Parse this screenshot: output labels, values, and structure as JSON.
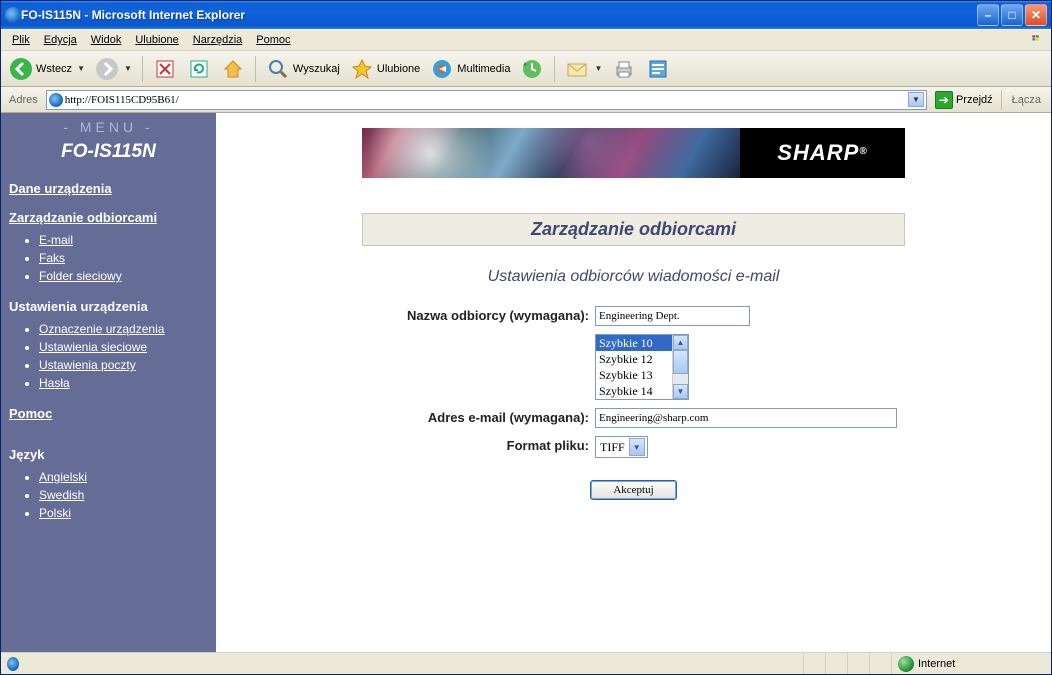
{
  "window": {
    "title": "FO-IS115N - Microsoft Internet Explorer"
  },
  "menubar": {
    "file": "Plik",
    "edit": "Edycja",
    "view": "Widok",
    "favorites": "Ulubione",
    "tools": "Narzędzia",
    "help": "Pomoc"
  },
  "toolbar": {
    "back": "Wstecz",
    "search": "Wyszukaj",
    "favorites": "Ulubione",
    "media": "Multimedia"
  },
  "addrbar": {
    "label": "Adres",
    "url": "http://FOIS115CD95B61/",
    "go": "Przejdź",
    "links": "Łącza"
  },
  "sidebar": {
    "menu_header": "- MENU -",
    "model": "FO-IS115N",
    "device_data": "Dane urządzenia",
    "recipients_mgmt": "Zarządzanie odbiorcami",
    "recip_items": {
      "email": "E-mail",
      "fax": "Faks",
      "netfolder": "Folder sieciowy"
    },
    "device_settings": "Ustawienia urządzenia",
    "settings_items": {
      "device_label": "Oznaczenie urządzenia",
      "network": "Ustawienia sieciowe",
      "mail": "Ustawienia poczty",
      "passwords": "Hasła"
    },
    "help": "Pomoc",
    "language": "Język",
    "lang_items": {
      "en": "Angielski",
      "sv": "Swedish",
      "pl": "Polski"
    }
  },
  "main": {
    "brand": "SHARP",
    "section_title": "Zarządzanie odbiorcami",
    "subtitle": "Ustawienia odbiorców wiadomości e-mail",
    "labels": {
      "name": "Nazwa odbiorcy (wymagana):",
      "email": "Adres e-mail (wymagana):",
      "format": "Format pliku:"
    },
    "values": {
      "name": "Engineering Dept.",
      "email": "Engineering@sharp.com",
      "format": "TIFF"
    },
    "list": {
      "o1": "Szybkie 10",
      "o2": "Szybkie 12",
      "o3": "Szybkie 13",
      "o4": "Szybkie 14"
    },
    "submit": "Akceptuj"
  },
  "statusbar": {
    "zone": "Internet"
  }
}
